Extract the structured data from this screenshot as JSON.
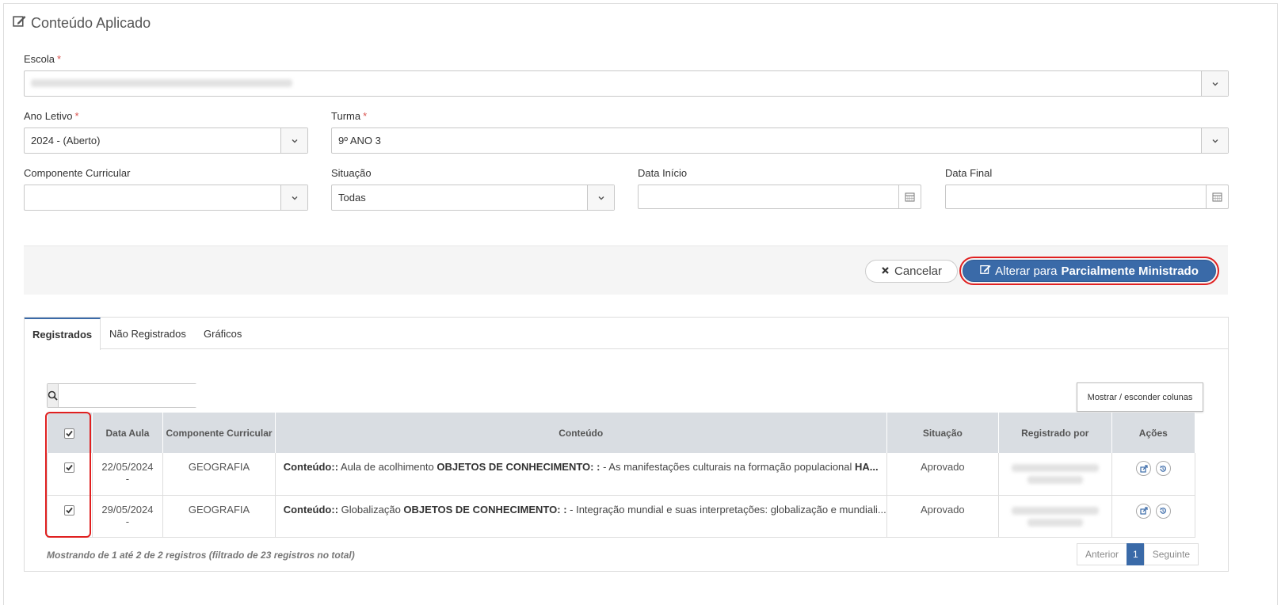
{
  "page": {
    "title": "Conteúdo Aplicado"
  },
  "form": {
    "escola_label": "Escola",
    "ano_label": "Ano Letivo",
    "ano_value": "2024 - (Aberto)",
    "turma_label": "Turma",
    "turma_value": "9º ANO 3",
    "componente_label": "Componente Curricular",
    "componente_value": "",
    "situacao_label": "Situação",
    "situacao_value": "Todas",
    "data_inicio_label": "Data Início",
    "data_final_label": "Data Final",
    "required_mark": "*"
  },
  "actions": {
    "cancel_label": "Cancelar",
    "primary_prefix": "Alterar para",
    "primary_bold": "Parcialmente Ministrado"
  },
  "tabs": [
    {
      "label": "Registrados"
    },
    {
      "label": "Não Registrados"
    },
    {
      "label": "Gráficos"
    }
  ],
  "table_tools": {
    "search_placeholder": "",
    "columns_button": "Mostrar / esconder colunas"
  },
  "table": {
    "headers": [
      "Data Aula",
      "Componente Curricular",
      "Conteúdo",
      "Situação",
      "Registrado por",
      "Ações"
    ],
    "rows": [
      {
        "date": "22/05/2024",
        "date_sub": "-",
        "componente": "GEOGRAFIA",
        "content_b1": "Conteúdo::",
        "content_t1": " Aula de acolhimento ",
        "content_b2": "OBJETOS DE CONHECIMENTO: :",
        "content_t2": " - As manifestações culturais na formação populacional ",
        "content_b3": "HA...",
        "situacao": "Aprovado"
      },
      {
        "date": "29/05/2024",
        "date_sub": "-",
        "componente": "GEOGRAFIA",
        "content_b1": "Conteúdo::",
        "content_t1": " Globalização ",
        "content_b2": "OBJETOS DE CONHECIMENTO: :",
        "content_t2": " - Integração mundial e suas interpretações: globalização e mundiali...",
        "content_b3": "",
        "situacao": "Aprovado"
      }
    ]
  },
  "footer": {
    "info": "Mostrando de 1 até 2 de 2 registros (filtrado de 23 registros no total)",
    "prev": "Anterior",
    "current": "1",
    "next": "Seguinte"
  }
}
